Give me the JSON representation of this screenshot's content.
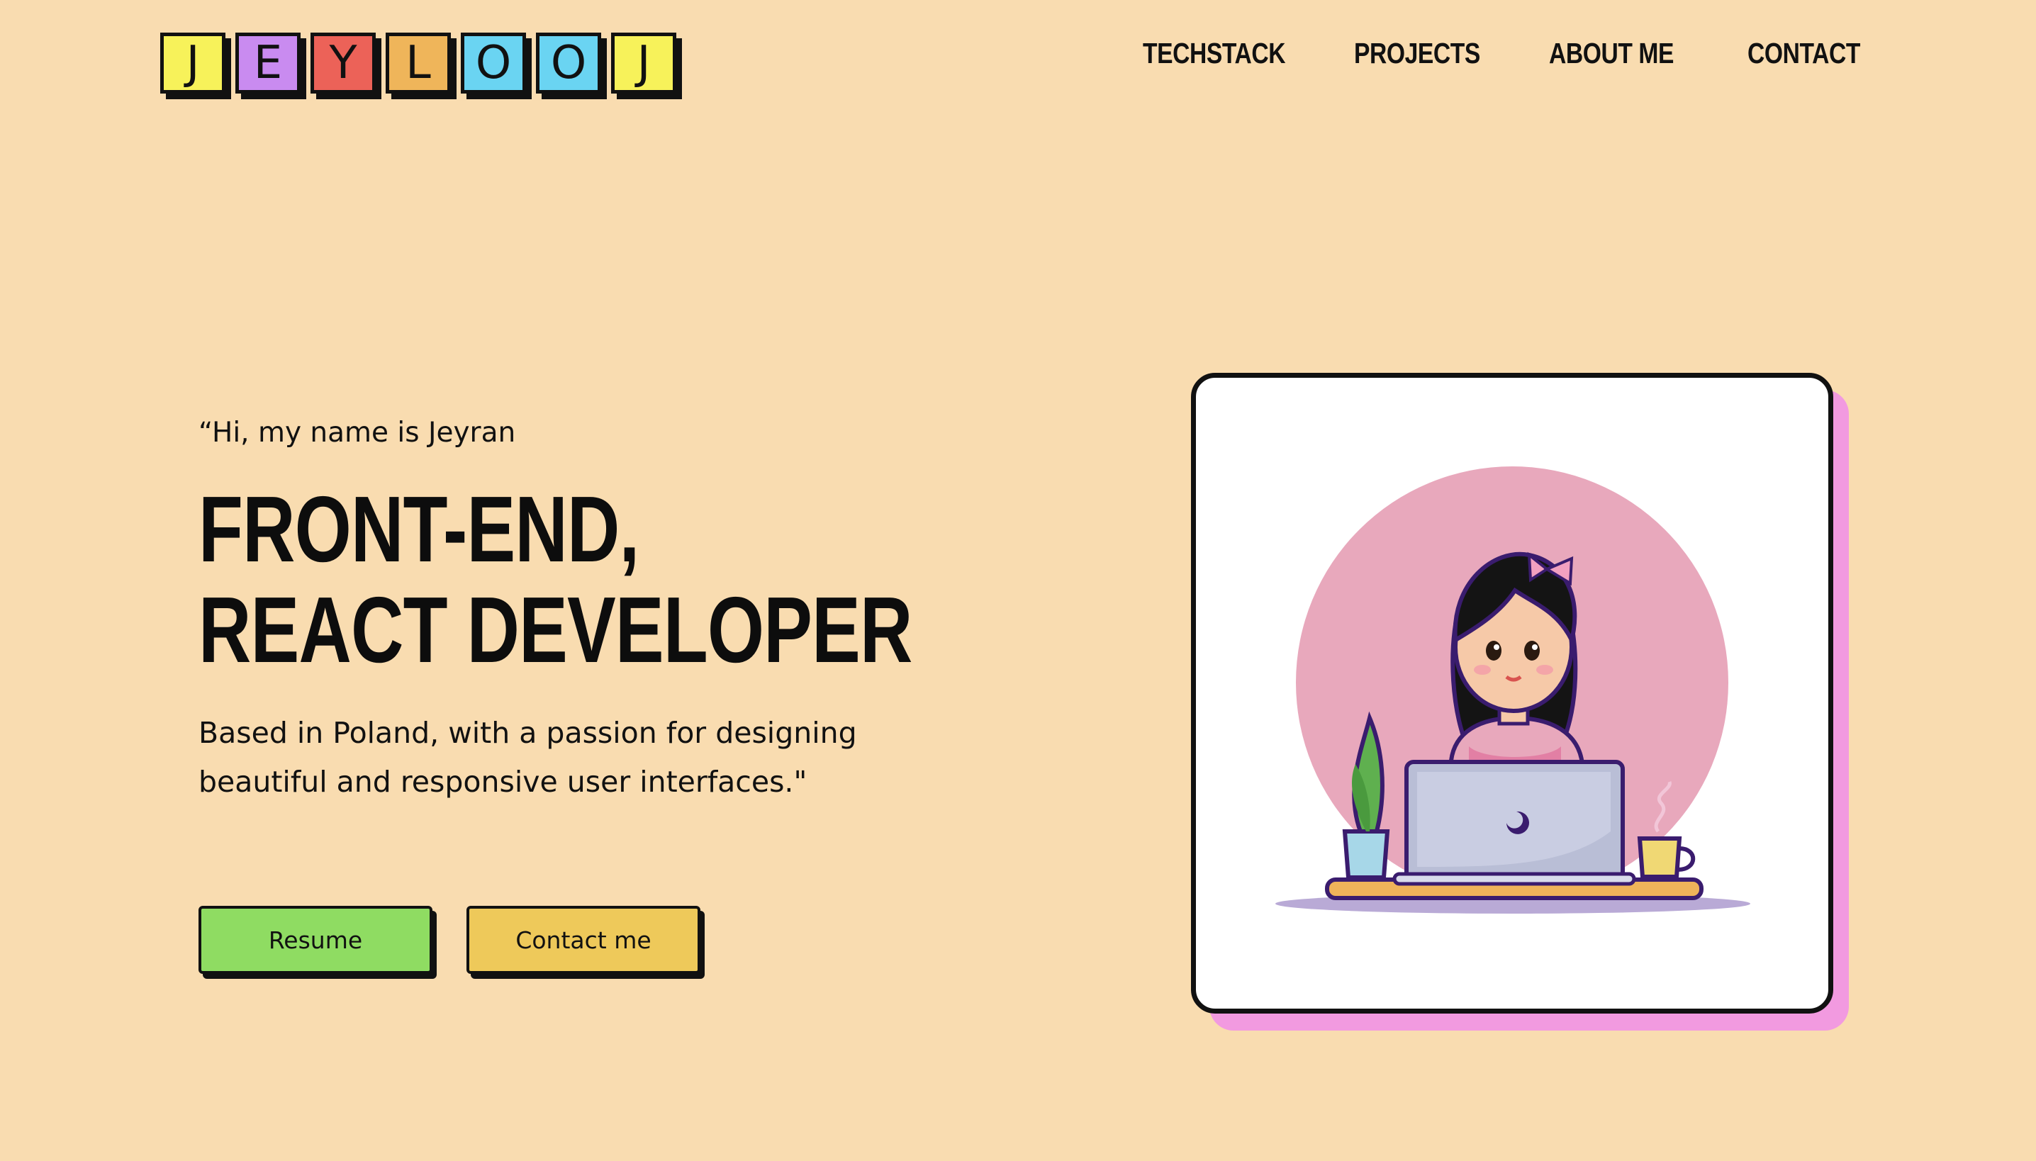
{
  "logo": {
    "letters": [
      {
        "char": "J",
        "color": "#f7f25a"
      },
      {
        "char": "E",
        "color": "#c98bf0"
      },
      {
        "char": "Y",
        "color": "#ec6258"
      },
      {
        "char": "L",
        "color": "#efb55a"
      },
      {
        "char": "O",
        "color": "#6ad4f2"
      },
      {
        "char": "O",
        "color": "#6ad4f2"
      },
      {
        "char": "J",
        "color": "#f7f25a"
      }
    ]
  },
  "nav": {
    "items": [
      "TECHSTACK",
      "PROJECTS",
      "ABOUT ME",
      "CONTACT"
    ]
  },
  "hero": {
    "greeting": "“Hi, my name is Jeyran",
    "headline_line1": "FRONT-END,",
    "headline_line2": "REACT DEVELOPER",
    "subtitle": "Based in Poland, with a passion for designing beautiful and responsive user interfaces.\""
  },
  "buttons": {
    "resume": "Resume",
    "contact": "Contact me"
  },
  "colors": {
    "background": "#f9dcb0",
    "card_shadow": "#f29ae0",
    "resume_button": "#8fdc62",
    "contact_button": "#eec95a"
  },
  "illustration": {
    "icon": "girl-working-on-laptop-illustration"
  }
}
